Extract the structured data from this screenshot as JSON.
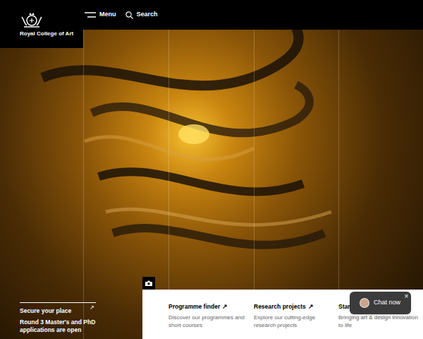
{
  "header": {
    "logo": "Royal College of Art",
    "menu": "Menu",
    "search": "Search"
  },
  "promo": {
    "title": "Secure your place",
    "arrow": "↗",
    "text": "Round 3 Master's and PhD applications are open"
  },
  "links": [
    {
      "title": "Programme finder",
      "arrow": "↗",
      "text": "Discover our programmes and short courses"
    },
    {
      "title": "Research projects",
      "arrow": "↗",
      "text": "Explore our cutting-edge research projects"
    },
    {
      "title": "Star",
      "text": "Bringing art & design innovation to life"
    }
  ],
  "chat": {
    "label": "Chat now",
    "close": "×"
  }
}
